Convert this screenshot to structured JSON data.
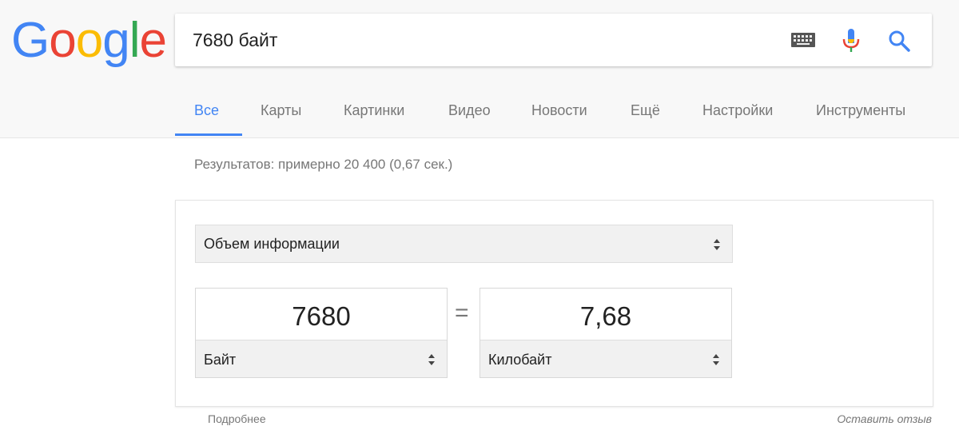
{
  "logo": {
    "letters": [
      "G",
      "o",
      "o",
      "g",
      "l",
      "e"
    ],
    "colors": [
      "#4285f4",
      "#ea4335",
      "#fbbc05",
      "#4285f4",
      "#34a853",
      "#ea4335"
    ]
  },
  "search": {
    "query": "7680 байт",
    "icons": [
      "keyboard-icon",
      "mic-icon",
      "search-icon"
    ]
  },
  "tabs": [
    {
      "label": "Все",
      "active": true
    },
    {
      "label": "Карты"
    },
    {
      "label": "Картинки"
    },
    {
      "label": "Видео"
    },
    {
      "label": "Новости"
    },
    {
      "label": "Ещё"
    },
    {
      "label": "Настройки"
    },
    {
      "label": "Инструменты"
    }
  ],
  "results": {
    "count_text": "Результатов: примерно 20 400 (0,67 сек.)"
  },
  "converter": {
    "category": "Объем информации",
    "from": {
      "value": "7680",
      "unit": "Байт"
    },
    "equals": "=",
    "to": {
      "value": "7,68",
      "unit": "Килобайт"
    }
  },
  "footer": {
    "more_link": "Подробнее",
    "feedback_link": "Оставить отзыв"
  },
  "colors": {
    "accent": "#4285f4",
    "header_bg": "#f8f8f8",
    "muted_text": "#777777"
  }
}
